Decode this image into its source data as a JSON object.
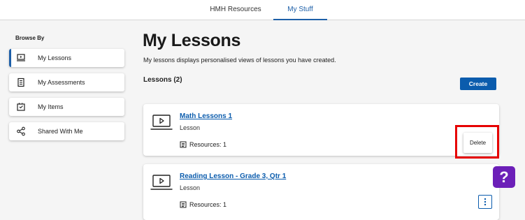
{
  "top_nav": {
    "tabs": [
      {
        "label": "HMH Resources",
        "active": false
      },
      {
        "label": "My Stuff",
        "active": true
      }
    ]
  },
  "sidebar": {
    "heading": "Browse By",
    "items": [
      {
        "label": "My Lessons",
        "icon": "laptop-play-icon",
        "active": true
      },
      {
        "label": "My Assessments",
        "icon": "checklist-icon",
        "active": false
      },
      {
        "label": "My Items",
        "icon": "items-icon",
        "active": false
      },
      {
        "label": "Shared With Me",
        "icon": "share-icon",
        "active": false
      }
    ]
  },
  "main": {
    "title": "My Lessons",
    "description": "My lessons displays personalised views of lessons you have created.",
    "count_label": "Lessons (2)",
    "create_label": "Create",
    "lessons": [
      {
        "title": "Math Lessons 1",
        "type": "Lesson",
        "resources": "Resources: 1",
        "action": "Delete"
      },
      {
        "title": "Reading Lesson - Grade 3, Qtr 1",
        "type": "Lesson",
        "resources": "Resources: 1"
      }
    ]
  },
  "help": {
    "label": "?"
  },
  "colors": {
    "accent": "#0b5cad",
    "highlight": "#e60000",
    "help": "#6c1fb8"
  }
}
